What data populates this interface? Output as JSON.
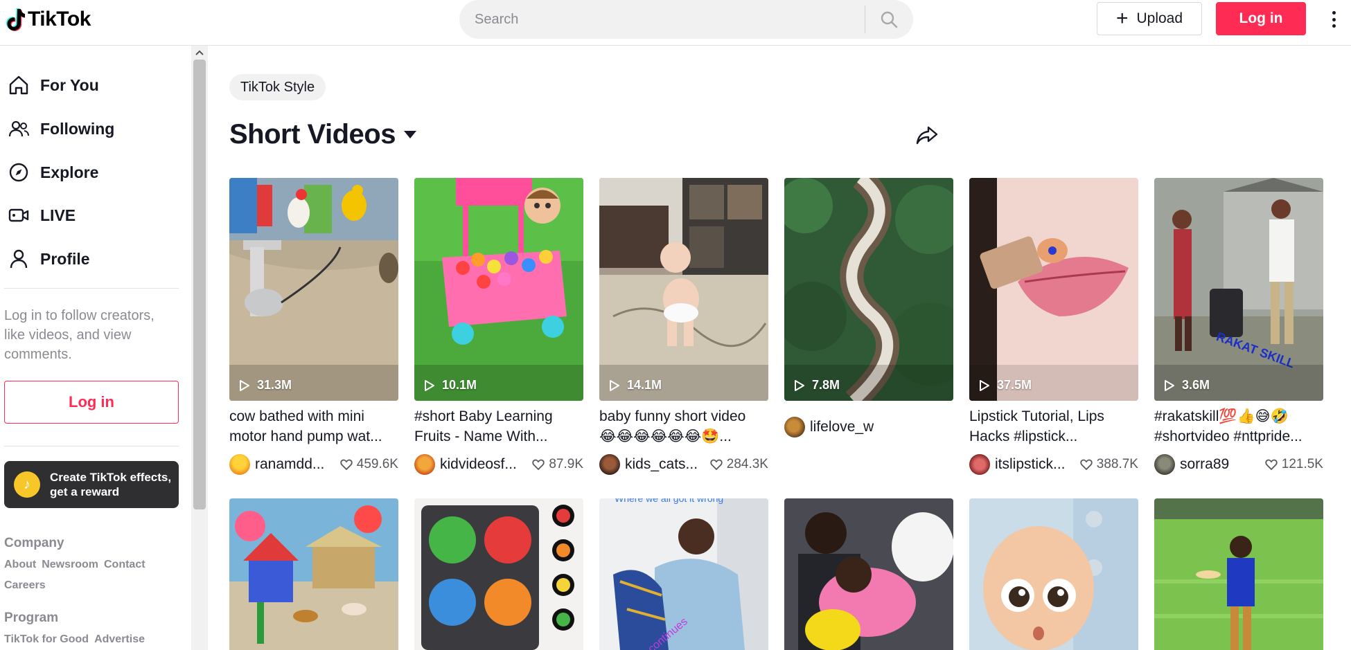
{
  "header": {
    "logo_text": "TikTok",
    "search_placeholder": "Search",
    "upload_label": "Upload",
    "login_label": "Log in"
  },
  "sidebar": {
    "nav": [
      {
        "label": "For You",
        "icon": "home-icon"
      },
      {
        "label": "Following",
        "icon": "people-icon"
      },
      {
        "label": "Explore",
        "icon": "compass-icon"
      },
      {
        "label": "LIVE",
        "icon": "live-icon"
      },
      {
        "label": "Profile",
        "icon": "profile-icon"
      }
    ],
    "login_hint": "Log in to follow creators, like videos, and view comments.",
    "login_button": "Log in",
    "effects_banner": "Create TikTok effects, get a reward",
    "company": {
      "title": "Company",
      "links": [
        "About",
        "Newsroom",
        "Contact",
        "Careers"
      ]
    },
    "program": {
      "title": "Program",
      "links": [
        "TikTok for Good",
        "Advertise"
      ]
    }
  },
  "main": {
    "chip": "TikTok Style",
    "title": "Short Videos",
    "videos": [
      {
        "views": "31.3M",
        "title_lines": [
          "cow bathed with mini",
          "motor hand pump wat..."
        ],
        "author": "ranamdd...",
        "likes": "459.6K"
      },
      {
        "views": "10.1M",
        "title_lines": [
          "#short Baby Learning",
          "Fruits - Name With..."
        ],
        "author": "kidvideosf...",
        "likes": "87.9K"
      },
      {
        "views": "14.1M",
        "title_lines": [
          "baby funny short video",
          "😂😂😂😂😂😂🤩..."
        ],
        "author": "kids_cats...",
        "likes": "284.3K"
      },
      {
        "views": "7.8M",
        "title_lines": [],
        "author": "lifelove_w",
        "likes": ""
      },
      {
        "views": "37.5M",
        "title_lines": [
          "Lipstick Tutorial, Lips",
          "Hacks #lipstick..."
        ],
        "author": "itslipstick...",
        "likes": "388.7K"
      },
      {
        "views": "3.6M",
        "title_lines": [
          "#rakatskill💯👍😅🤣",
          "#shortvideo #nttpride..."
        ],
        "author": "sorra89",
        "likes": "121.5K"
      }
    ],
    "second_row_overlay": "Where we all got it wrong",
    "colors": {
      "accent": "#fe2c55",
      "text": "#161823",
      "muted": "#8a8b91"
    }
  }
}
